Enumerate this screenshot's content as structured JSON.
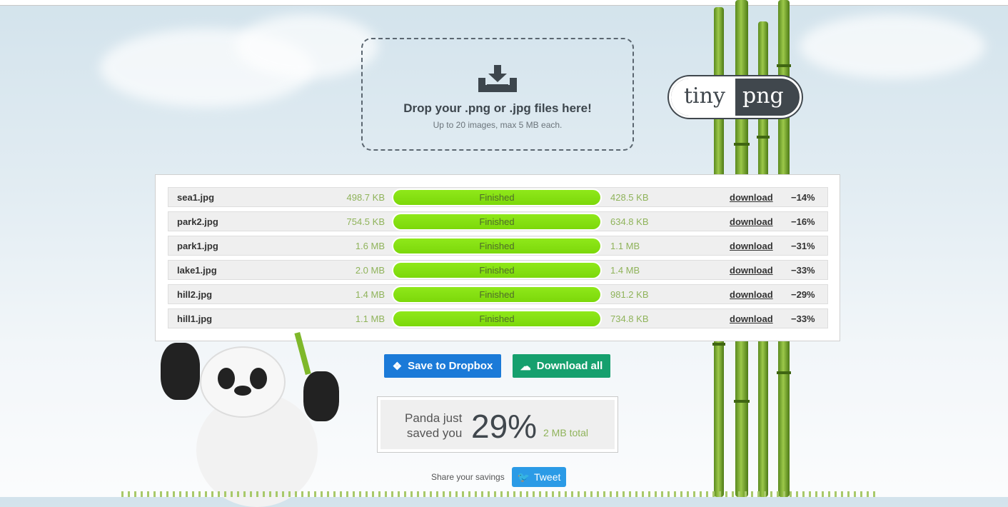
{
  "dropzone": {
    "title": "Drop your .png or .jpg files here!",
    "subtitle": "Up to 20 images, max 5 MB each."
  },
  "logo": {
    "left": "tiny",
    "right": "png"
  },
  "files": [
    {
      "name": "sea1.jpg",
      "original": "498.7 KB",
      "status": "Finished",
      "progress": 100,
      "compressed": "428.5 KB",
      "link": "download",
      "saving": "−14%"
    },
    {
      "name": "park2.jpg",
      "original": "754.5 KB",
      "status": "Finished",
      "progress": 100,
      "compressed": "634.8 KB",
      "link": "download",
      "saving": "−16%"
    },
    {
      "name": "park1.jpg",
      "original": "1.6 MB",
      "status": "Finished",
      "progress": 100,
      "compressed": "1.1 MB",
      "link": "download",
      "saving": "−31%"
    },
    {
      "name": "lake1.jpg",
      "original": "2.0 MB",
      "status": "Finished",
      "progress": 100,
      "compressed": "1.4 MB",
      "link": "download",
      "saving": "−33%"
    },
    {
      "name": "hill2.jpg",
      "original": "1.4 MB",
      "status": "Finished",
      "progress": 100,
      "compressed": "981.2 KB",
      "link": "download",
      "saving": "−29%"
    },
    {
      "name": "hill1.jpg",
      "original": "1.1 MB",
      "status": "Finished",
      "progress": 100,
      "compressed": "734.8 KB",
      "link": "download",
      "saving": "−33%"
    }
  ],
  "actions": {
    "dropbox": "Save to Dropbox",
    "download_all": "Download all"
  },
  "savings": {
    "line1": "Panda just",
    "line2": "saved you",
    "percent": "29%",
    "total": "2 MB total"
  },
  "share": {
    "label": "Share your savings",
    "tweet": "Tweet"
  },
  "colors": {
    "dropbox": "#1b7ad8",
    "download": "#16a06e",
    "progress": "#86e012",
    "tweet": "#2b9be6"
  }
}
